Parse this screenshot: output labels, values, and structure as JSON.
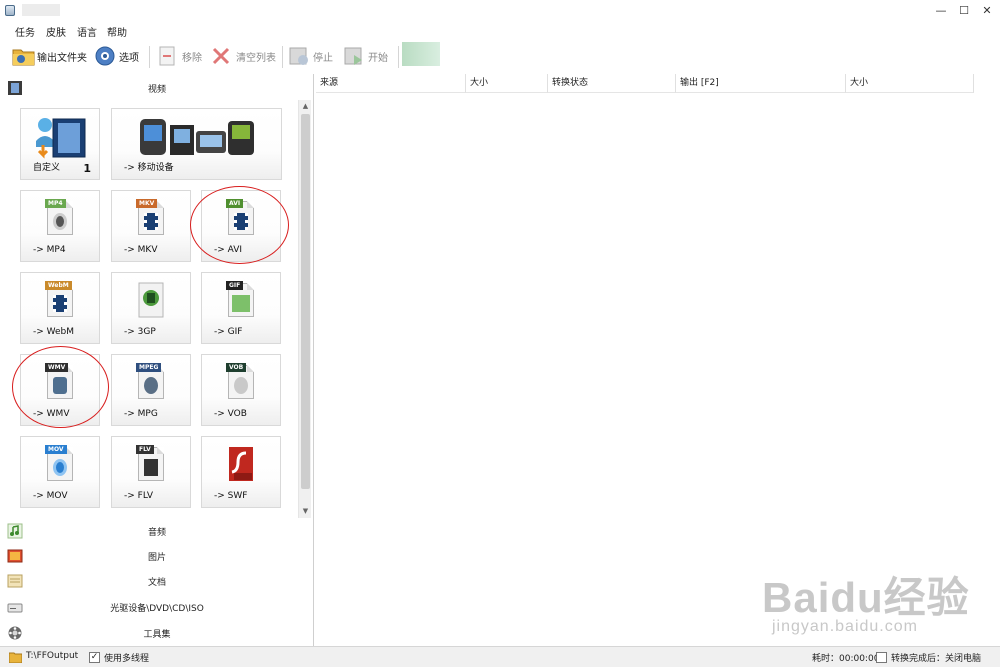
{
  "window": {
    "controls": {
      "minimize": "—",
      "maximize": "☐",
      "close": "✕"
    }
  },
  "menu": [
    "任务",
    "皮肤",
    "语言",
    "帮助"
  ],
  "toolbar": {
    "output_folder": "输出文件夹",
    "options": "选项",
    "remove": "移除",
    "clear_list": "清空列表",
    "stop": "停止",
    "start": "开始"
  },
  "left": {
    "video_category": "视频",
    "tiles": [
      {
        "label": "自定义",
        "number": "1"
      },
      {
        "label": "-> 移动设备"
      },
      {
        "label": "-> MP4",
        "badge": "MP4",
        "badge_color": "#6aa84f"
      },
      {
        "label": "-> MKV",
        "badge": "MKV",
        "badge_color": "#c96a2b"
      },
      {
        "label": "-> AVI",
        "badge": "AVI",
        "badge_color": "#4f8f2f"
      },
      {
        "label": "-> WebM",
        "badge": "WebM",
        "badge_color": "#c98a2b"
      },
      {
        "label": "-> 3GP"
      },
      {
        "label": "-> GIF",
        "badge": "GIF",
        "badge_color": "#222222"
      },
      {
        "label": "-> WMV",
        "badge": "WMV",
        "badge_color": "#2f2f2f"
      },
      {
        "label": "-> MPG",
        "badge": "MPEG",
        "badge_color": "#2f4f7f"
      },
      {
        "label": "-> VOB",
        "badge": "VOB",
        "badge_color": "#1f3f2f"
      },
      {
        "label": "-> MOV",
        "badge": "MOV",
        "badge_color": "#2a7fd0"
      },
      {
        "label": "-> FLV",
        "badge": "FLV",
        "badge_color": "#333333"
      },
      {
        "label": "-> SWF",
        "badge": "SWF",
        "badge_color": "#c0281f"
      }
    ],
    "categories": [
      "音频",
      "图片",
      "文档",
      "光驱设备\\DVD\\CD\\ISO",
      "工具集"
    ]
  },
  "table": {
    "columns": [
      "来源",
      "大小",
      "转换状态",
      "输出 [F2]",
      "大小"
    ]
  },
  "status": {
    "output_path": "T:\\FFOutput",
    "multithread": "使用多线程",
    "elapsed": "耗时：00:00:00",
    "after_convert": "转换完成后：关闭电脑"
  },
  "watermark": {
    "main": "Baidu经验",
    "sub": "jingyan.baidu.com"
  }
}
